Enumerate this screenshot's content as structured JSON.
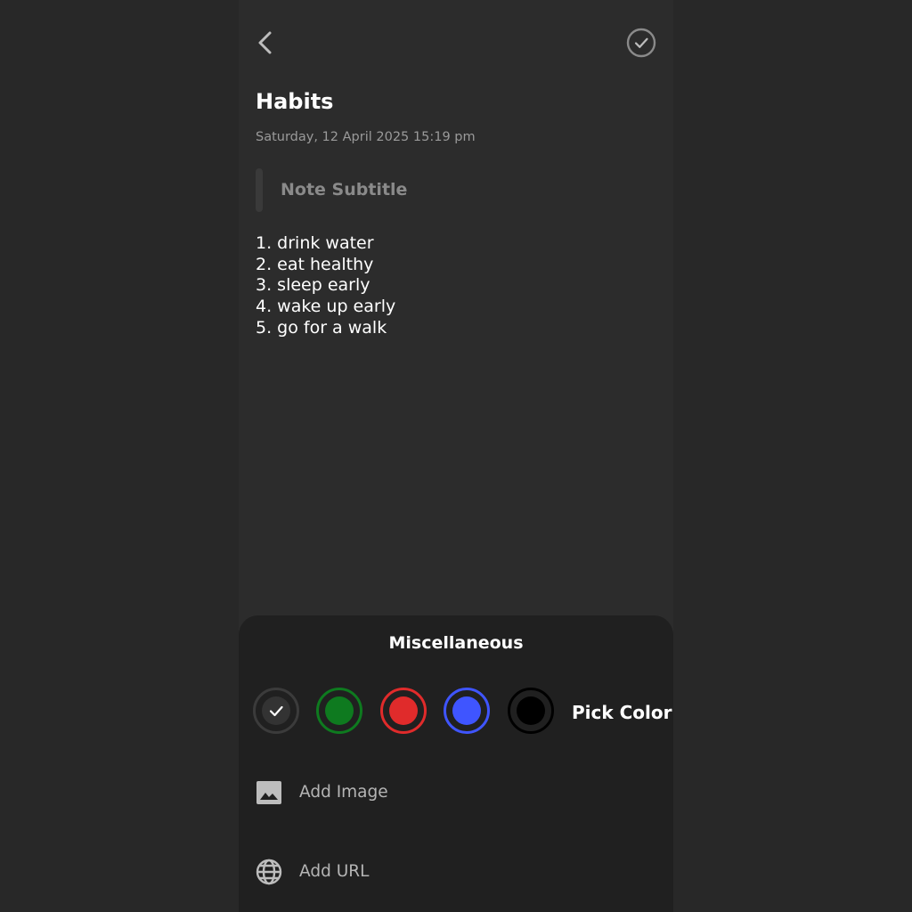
{
  "note": {
    "title": "Habits",
    "datetime": "Saturday, 12 April 2025 15:19 pm",
    "subtitle_placeholder": "Note Subtitle",
    "lines": [
      "1. drink water",
      "2. eat healthy",
      "3. sleep early",
      "4. wake up early",
      "5. go for a walk"
    ]
  },
  "header": {
    "back_icon": "chevron-left-icon",
    "done_icon": "check-circle-icon"
  },
  "sheet": {
    "title": "Miscellaneous",
    "colors": [
      {
        "name": "dark-gray",
        "fill": "#333333",
        "ring": "#3b3b3b",
        "selected": true
      },
      {
        "name": "green",
        "fill": "#0e7a1f",
        "ring": "#0e7a1f",
        "selected": false
      },
      {
        "name": "red",
        "fill": "#e02b2b",
        "ring": "#e02b2b",
        "selected": false
      },
      {
        "name": "blue",
        "fill": "#3f55ff",
        "ring": "#3f55ff",
        "selected": false
      },
      {
        "name": "black",
        "fill": "#000000",
        "ring": "#000000",
        "selected": false
      }
    ],
    "pick_color_label": "Pick Color",
    "add_image_label": "Add Image",
    "add_url_label": "Add URL",
    "add_image_icon": "image-icon",
    "add_url_icon": "globe-icon"
  },
  "theme": {
    "background": "#282828",
    "surface": "#2c2c2c",
    "sheet": "#202020",
    "text_primary": "#ffffff",
    "text_secondary": "#9a9a9a"
  }
}
